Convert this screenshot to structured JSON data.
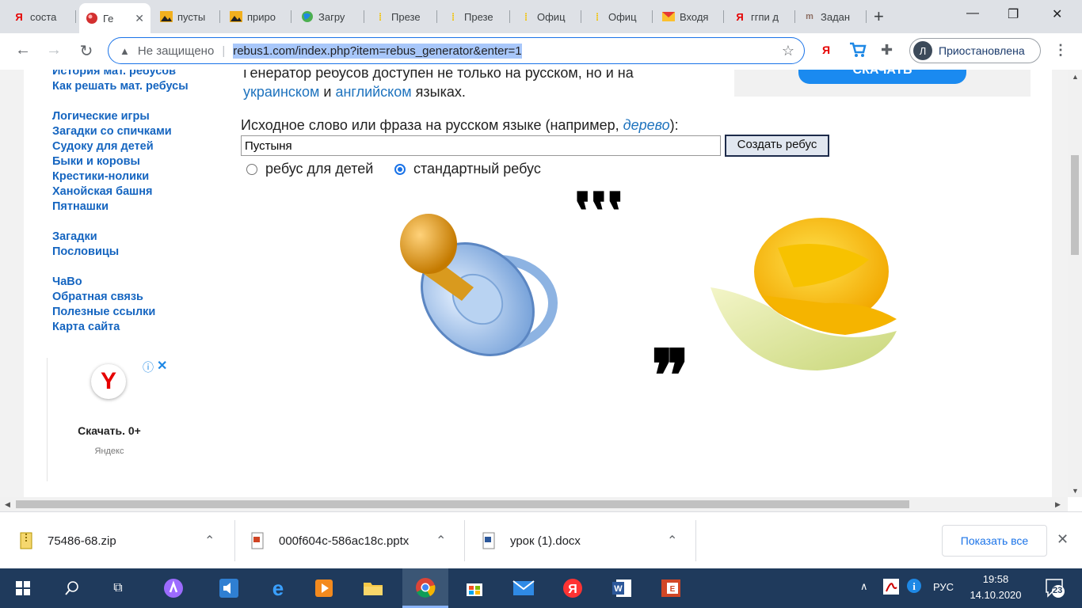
{
  "tabs": [
    {
      "title": "соста",
      "icon": "yandex-icon",
      "color": "#e60000"
    },
    {
      "title": "Ге",
      "icon": "rebus-site-icon",
      "color": "#d32f2f"
    },
    {
      "title": "пусты",
      "icon": "image-search-icon",
      "color": "#f2b01e"
    },
    {
      "title": "приро",
      "icon": "image-search-icon",
      "color": "#f2b01e"
    },
    {
      "title": "Загру",
      "icon": "globe-icon",
      "color": "#4caf50"
    },
    {
      "title": "Презе",
      "icon": "document-icon",
      "color": "#f2c200"
    },
    {
      "title": "Презе",
      "icon": "document-icon",
      "color": "#f2c200"
    },
    {
      "title": "Офиц",
      "icon": "document-icon",
      "color": "#f2c200"
    },
    {
      "title": "Офиц",
      "icon": "document-icon",
      "color": "#f2c200"
    },
    {
      "title": "Входя",
      "icon": "mail-icon",
      "color": "#e53935"
    },
    {
      "title": "ггпи д",
      "icon": "yandex-icon",
      "color": "#e60000"
    },
    {
      "title": "Задан",
      "icon": "tasks-icon",
      "color": "#8d6e63"
    }
  ],
  "toolbar": {
    "security_label": "Не защищено",
    "url": "rebus1.com/index.php?item=rebus_generator&enter=1",
    "profile_initial": "Л",
    "profile_label": "Приостановлена",
    "yandex_letter": "Я"
  },
  "sidebar": {
    "groups": [
      [
        "История мат. ребусов",
        "Как решать мат. ребусы"
      ],
      [
        "Логические игры",
        "Загадки со спичками",
        "Судоку для детей",
        "Быки и коровы",
        "Крестики-нолики",
        "Ханойская башня",
        "Пятнашки"
      ],
      [
        "Загадки",
        "Пословицы"
      ],
      [
        "ЧаВо",
        "Обратная связь",
        "Полезные ссылки",
        "Карта сайта"
      ]
    ]
  },
  "intro": {
    "line1": "Генератор ребусов доступен не только на русском, но и на",
    "lang1": "украинском",
    "and": "и",
    "lang2": "английском",
    "tail": "языках."
  },
  "download_button": "СКАЧАТЬ",
  "form": {
    "prompt_before": "Исходное слово или фраза на русском языке (например, ",
    "example": "дерево",
    "prompt_after": "):",
    "word_value": "Пустыня",
    "create_label": "Создать ребус",
    "radio_kids": "ребус для детей",
    "radio_standard": "стандартный ребус",
    "selected": "standard"
  },
  "rebus": {
    "left_quotes": "❜❜❜",
    "right_quotes": "❞"
  },
  "ad": {
    "logo_letter": "Y",
    "title": "Скачать. 0+",
    "source": "Яндекс"
  },
  "downloads": [
    {
      "name": "75486-68.zip",
      "icon": "zip-file-icon"
    },
    {
      "name": "000f604c-586ac18c.pptx",
      "icon": "pptx-file-icon"
    },
    {
      "name": "урок (1).docx",
      "icon": "docx-file-icon"
    }
  ],
  "show_all": "Показать все",
  "taskbar": {
    "lang": "РУС",
    "time": "19:58",
    "date": "14.10.2020",
    "notifications": "23"
  }
}
